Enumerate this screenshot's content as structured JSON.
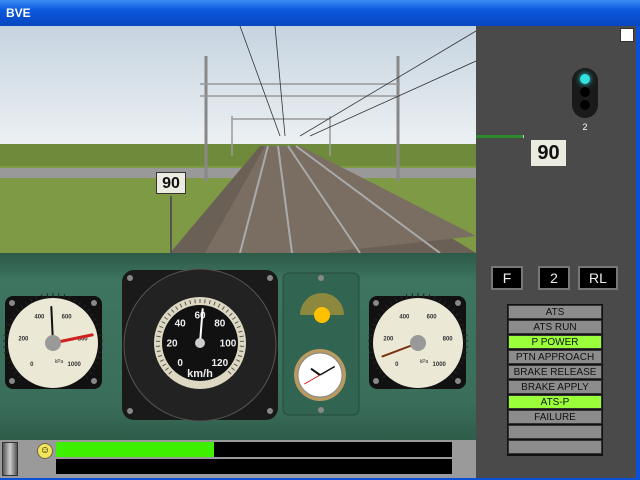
{
  "window": {
    "title": "BVE"
  },
  "scene": {
    "trackside_speed_sign": "90"
  },
  "side_panel": {
    "signal_aspect": "proceed",
    "signal_color": "#33e0e0",
    "signal_number": "2",
    "speed_limit": "90",
    "modes": {
      "reverser": "F",
      "notch": "2",
      "ats": "RL"
    },
    "indicators": [
      {
        "label": "ATS",
        "on": false
      },
      {
        "label": "ATS RUN",
        "on": false
      },
      {
        "label": "P POWER",
        "on": true
      },
      {
        "label": "PTN APPROACH",
        "on": false
      },
      {
        "label": "BRAKE RELEASE",
        "on": false
      },
      {
        "label": "BRAKE APPLY",
        "on": false
      },
      {
        "label": "ATS-P",
        "on": true
      },
      {
        "label": "FAILURE",
        "on": false
      },
      {
        "label": "",
        "on": false
      },
      {
        "label": "",
        "on": false
      }
    ]
  },
  "cab": {
    "speedometer": {
      "unit": "km/h",
      "value": 62,
      "max": 120,
      "labels": [
        "0",
        "20",
        "40",
        "60",
        "80",
        "100",
        "120"
      ]
    },
    "left_gauge": {
      "unit": "kPa",
      "labels": [
        "0",
        "200",
        "400",
        "600",
        "800",
        "1000"
      ],
      "black_needle": 490,
      "red_needle": 790
    },
    "right_gauge": {
      "unit": "kPa",
      "labels": [
        "0",
        "200",
        "400",
        "600",
        "800",
        "1000"
      ],
      "needle": 90
    },
    "clock": {
      "hours": 10,
      "minutes": 10,
      "seconds": 40
    }
  },
  "status_bar": {
    "progress_percent": 40
  }
}
